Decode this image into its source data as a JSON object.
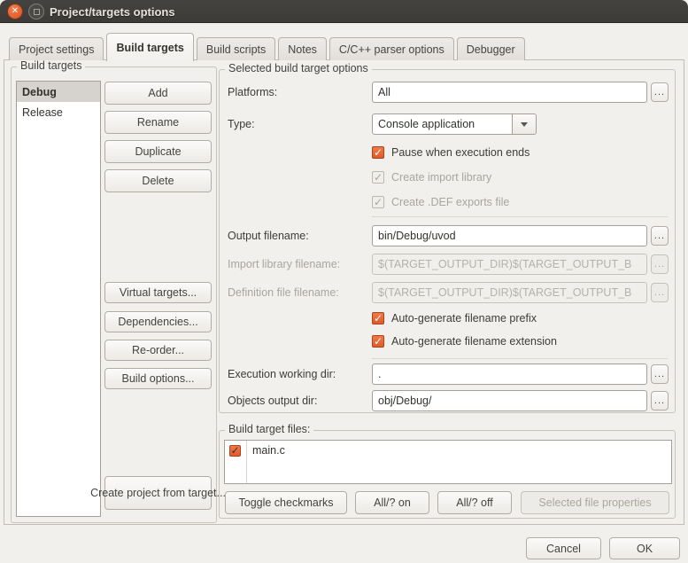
{
  "titlebar": {
    "title": "Project/targets options"
  },
  "tabs": [
    {
      "label": "Project settings",
      "active": false
    },
    {
      "label": "Build targets",
      "active": true
    },
    {
      "label": "Build scripts",
      "active": false
    },
    {
      "label": "Notes",
      "active": false
    },
    {
      "label": "C/C++ parser options",
      "active": false
    },
    {
      "label": "Debugger",
      "active": false
    }
  ],
  "build_targets": {
    "group_label": "Build targets",
    "list": [
      {
        "label": "Debug",
        "selected": true
      },
      {
        "label": "Release",
        "selected": false
      }
    ],
    "actions_top": [
      {
        "label": "Add"
      },
      {
        "label": "Rename"
      },
      {
        "label": "Duplicate"
      },
      {
        "label": "Delete"
      }
    ],
    "actions_mid": [
      {
        "label": "Virtual targets..."
      },
      {
        "label": "Dependencies..."
      },
      {
        "label": "Re-order..."
      },
      {
        "label": "Build options..."
      }
    ],
    "action_create": {
      "label": "Create project from target..."
    }
  },
  "options": {
    "group_label": "Selected build target options",
    "browse_label": "...",
    "platforms": {
      "label": "Platforms:",
      "value": "All"
    },
    "type": {
      "label": "Type:",
      "value": "Console application"
    },
    "checkboxes": {
      "pause": {
        "label": "Pause when execution ends",
        "checked": true,
        "enabled": true
      },
      "create_import_library": {
        "label": "Create import library",
        "checked": true,
        "enabled": false
      },
      "create_def_exports": {
        "label": "Create .DEF exports file",
        "checked": true,
        "enabled": false
      },
      "auto_prefix": {
        "label": "Auto-generate filename prefix",
        "checked": true,
        "enabled": true
      },
      "auto_extension": {
        "label": "Auto-generate filename extension",
        "checked": true,
        "enabled": true
      }
    },
    "output_filename": {
      "label": "Output filename:",
      "value": "bin/Debug/uvod",
      "enabled": true
    },
    "import_library_filename": {
      "label": "Import library filename:",
      "value": "$(TARGET_OUTPUT_DIR)$(TARGET_OUTPUT_B",
      "enabled": false
    },
    "definition_file_filename": {
      "label": "Definition file filename:",
      "value": "$(TARGET_OUTPUT_DIR)$(TARGET_OUTPUT_B",
      "enabled": false
    },
    "execution_working_dir": {
      "label": "Execution working dir:",
      "value": "."
    },
    "objects_output_dir": {
      "label": "Objects output dir:",
      "value": "obj/Debug/"
    }
  },
  "build_target_files": {
    "group_label": "Build target files:",
    "files": [
      {
        "name": "main.c",
        "checked": true
      }
    ],
    "buttons": [
      {
        "label": "Toggle checkmarks",
        "enabled": true
      },
      {
        "label": "All/? on",
        "enabled": true
      },
      {
        "label": "All/? off",
        "enabled": true
      },
      {
        "label": "Selected file properties",
        "enabled": false
      }
    ]
  },
  "footer": {
    "cancel_label": "Cancel",
    "ok_label": "OK"
  },
  "colors": {
    "accent_orange": "#e05a2b",
    "titlebar_bg": "#3c3b37",
    "dialog_bg": "#f1f0ed"
  }
}
